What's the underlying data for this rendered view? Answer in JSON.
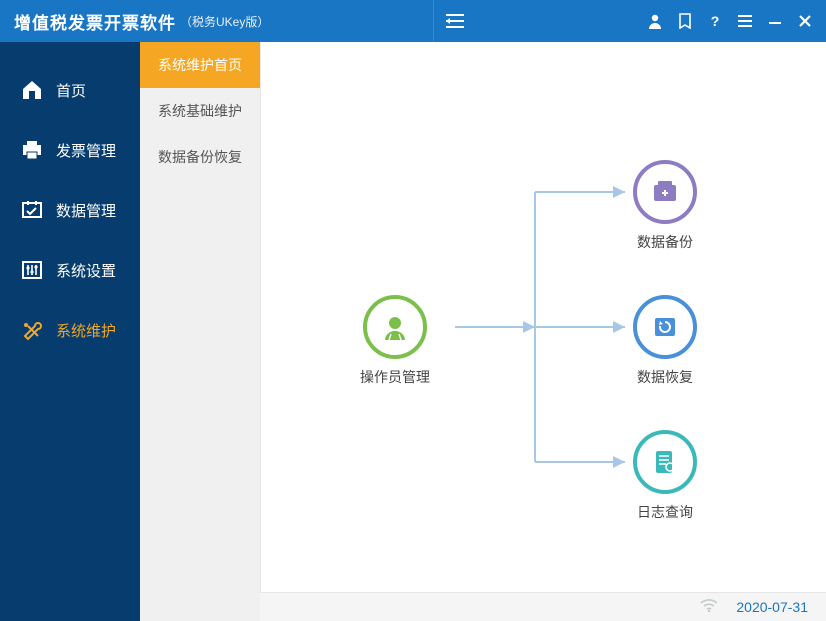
{
  "app": {
    "title": "增值税发票开票软件",
    "subtitle": "（税务UKey版）"
  },
  "sidebar": {
    "items": [
      {
        "label": "首页"
      },
      {
        "label": "发票管理"
      },
      {
        "label": "数据管理"
      },
      {
        "label": "系统设置"
      },
      {
        "label": "系统维护"
      }
    ]
  },
  "submenu": {
    "items": [
      {
        "label": "系统维护首页"
      },
      {
        "label": "系统基础维护"
      },
      {
        "label": "数据备份恢复"
      }
    ]
  },
  "diagram": {
    "root": {
      "label": "操作员管理"
    },
    "children": [
      {
        "label": "数据备份"
      },
      {
        "label": "数据恢复"
      },
      {
        "label": "日志查询"
      }
    ]
  },
  "status": {
    "date": "2020-07-31"
  }
}
